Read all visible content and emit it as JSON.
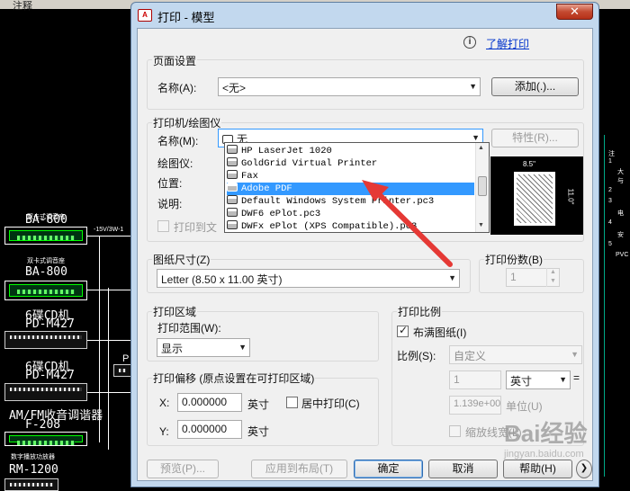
{
  "cad": {
    "menu_fragment": "注释",
    "labels": [
      {
        "name": "device-label-1-top",
        "text": "双卡式调音座"
      },
      {
        "name": "device-label-1",
        "text": "BA-800"
      },
      {
        "name": "device-label-2-top",
        "text": "双卡式调音座"
      },
      {
        "name": "device-label-2",
        "text": "BA-800"
      },
      {
        "name": "device-label-3-top",
        "text": "6碟CD机"
      },
      {
        "name": "device-label-3",
        "text": "PD-M427"
      },
      {
        "name": "device-label-4-top",
        "text": "6碟CD机"
      },
      {
        "name": "device-label-4",
        "text": "PD-M427"
      },
      {
        "name": "device-label-5-top",
        "text": "AM/FM收音调谐器"
      },
      {
        "name": "device-label-5",
        "text": "F-208"
      },
      {
        "name": "device-label-6-top",
        "text": "数字播放功放器"
      },
      {
        "name": "device-label-6",
        "text": "RM-1200"
      }
    ],
    "wire_note": "-15V/3W-1",
    "right_notes": [
      "注",
      "1",
      "大",
      "与",
      "2",
      "3",
      "电",
      "4",
      "安",
      "5",
      "PVC"
    ]
  },
  "dialog": {
    "title": "打印 - 模型",
    "icon_text": "A",
    "close_label": "✕",
    "help_link": "了解打印",
    "page_setup": {
      "group_title": "页面设置",
      "name_label": "名称(A):",
      "name_value": "<无>",
      "add_button": "添加(.)..."
    },
    "printer": {
      "group_title": "打印机/绘图仪",
      "name_label": "名称(M):",
      "name_value": "无",
      "properties_button": "特性(R)...",
      "plotter_label": "绘图仪:",
      "location_label": "位置:",
      "description_label": "说明:",
      "print_to_file_label": "打印到文",
      "options": [
        "HP LaserJet 1020",
        "GoldGrid Virtual Printer",
        "Fax",
        "Adobe PDF",
        "Default Windows System Printer.pc3",
        "DWF6 ePlot.pc3",
        "DWFx ePlot (XPS Compatible).pc3"
      ],
      "selected_option": "Adobe PDF",
      "preview_width": "8.5\"",
      "preview_height": "11.0\""
    },
    "paper": {
      "group_title": "图纸尺寸(Z)",
      "value": "Letter (8.50 x 11.00 英寸)"
    },
    "copies": {
      "group_title": "打印份数(B)",
      "value": "1"
    },
    "area": {
      "group_title": "打印区域",
      "range_label": "打印范围(W):",
      "range_value": "显示"
    },
    "scale": {
      "group_title": "打印比例",
      "fit_label": "布满图纸(I)",
      "fit_checked": true,
      "ratio_label": "比例(S):",
      "ratio_value": "自定义",
      "num1": "1",
      "unit_value": "英寸",
      "equals": "=",
      "num2": "1.139e+00",
      "unit_label": "单位(U)",
      "lineweight_label": "缩放线宽(L)"
    },
    "offset": {
      "group_title": "打印偏移 (原点设置在可打印区域)",
      "x_label": "X:",
      "x_value": "0.000000",
      "y_label": "Y:",
      "y_value": "0.000000",
      "unit": "英寸",
      "center_label": "居中打印(C)"
    },
    "buttons": {
      "preview": "预览(P)...",
      "apply": "应用到布局(T)",
      "ok": "确定",
      "cancel": "取消",
      "help": "帮助(H)"
    }
  },
  "watermark": {
    "main": "Bai经验",
    "sub": "jingyan.baidu.com"
  },
  "colors": {
    "accent_arrow": "#e53935",
    "selection": "#3399ff"
  }
}
